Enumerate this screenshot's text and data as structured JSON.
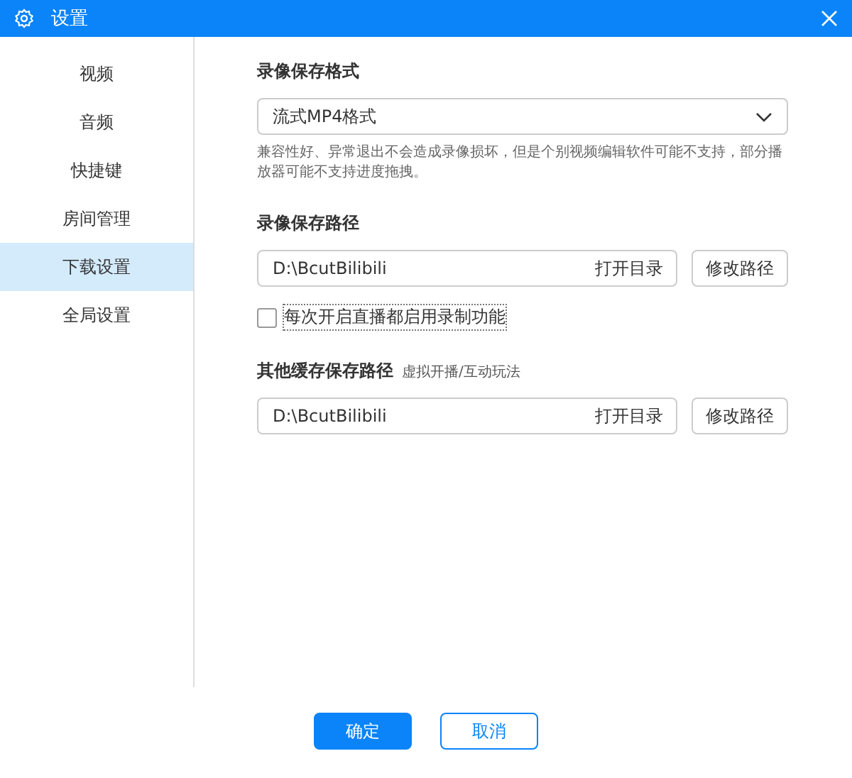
{
  "window": {
    "title": "设置"
  },
  "sidebar": {
    "items": [
      {
        "label": "视频",
        "selected": false
      },
      {
        "label": "音频",
        "selected": false
      },
      {
        "label": "快捷键",
        "selected": false
      },
      {
        "label": "房间管理",
        "selected": false
      },
      {
        "label": "下载设置",
        "selected": true
      },
      {
        "label": "全局设置",
        "selected": false
      }
    ]
  },
  "format": {
    "heading": "录像保存格式",
    "value": "流式MP4格式",
    "hint": "兼容性好、异常退出不会造成录像损坏，但是个别视频编辑软件可能不支持，部分播放器可能不支持进度拖拽。"
  },
  "record_path": {
    "heading": "录像保存路径",
    "value": "D:\\BcutBilibili",
    "open_label": "打开目录",
    "change_button": "修改路径"
  },
  "auto_record": {
    "label": "每次开启直播都启用录制功能",
    "checked": false
  },
  "cache_path": {
    "heading": "其他缓存保存路径",
    "note": "虚拟开播/互动玩法",
    "value": "D:\\BcutBilibili",
    "open_label": "打开目录",
    "change_button": "修改路径"
  },
  "buttons": [
    {
      "label": "确定",
      "kind": "primary"
    },
    {
      "label": "取消",
      "kind": "secondary"
    }
  ]
}
